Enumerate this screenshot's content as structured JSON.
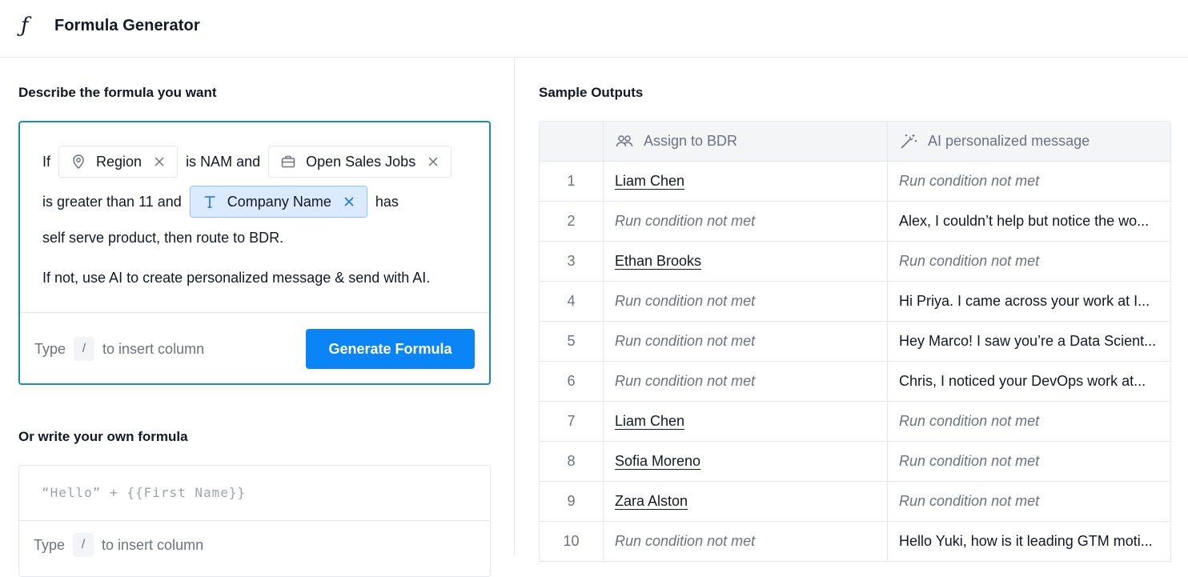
{
  "app": {
    "title": "Formula Generator",
    "icon": "function-icon"
  },
  "left": {
    "describe_title": "Describe the formula you want",
    "prompt": {
      "line1": {
        "prefix": "If",
        "chip1": "Region",
        "middle": "is NAM and",
        "chip2": "Open Sales Jobs"
      },
      "line2": {
        "prefix": "is greater than 11 and",
        "chip3": "Company Name",
        "suffix": "has"
      },
      "line3": "self serve product, then route to BDR.",
      "line4": "If not, use AI to create personalized message & send with AI."
    },
    "hint": {
      "type": "Type",
      "key": "/",
      "rest": "to insert column"
    },
    "generate_label": "Generate Formula",
    "own_title": "Or write your own formula",
    "own_placeholder": "“Hello” + {{First Name}}",
    "own_hint": {
      "type": "Type",
      "key": "/",
      "rest": "to insert column"
    }
  },
  "right": {
    "title": "Sample Outputs",
    "columns": [
      "Assign to BDR",
      "AI personalized message"
    ],
    "rows": [
      {
        "n": "1",
        "bdr": "Liam Chen",
        "msg": "Run condition not met"
      },
      {
        "n": "2",
        "bdr": "Run condition not met",
        "msg": "Alex, I couldn’t help but notice the wo..."
      },
      {
        "n": "3",
        "bdr": "Ethan Brooks",
        "msg": "Run condition not met"
      },
      {
        "n": "4",
        "bdr": "Run condition not met",
        "msg": "Hi Priya. I came across your work at I..."
      },
      {
        "n": "5",
        "bdr": "Run condition not met",
        "msg": "Hey Marco! I saw you’re a Data Scient..."
      },
      {
        "n": "6",
        "bdr": "Run condition not met",
        "msg": "Chris, I noticed your DevOps work at..."
      },
      {
        "n": "7",
        "bdr": "Liam Chen",
        "msg": "Run condition not met"
      },
      {
        "n": "8",
        "bdr": "Sofia Moreno",
        "msg": "Run condition not met"
      },
      {
        "n": "9",
        "bdr": "Zara Alston",
        "msg": "Run condition not met"
      },
      {
        "n": "10",
        "bdr": "Run condition not met",
        "msg": "Hello Yuki, how is it leading GTM moti..."
      }
    ]
  },
  "colors": {
    "accent": "#0b84f5",
    "focus_border": "#1a86d6",
    "chip_active_bg": "#dbeafe"
  }
}
